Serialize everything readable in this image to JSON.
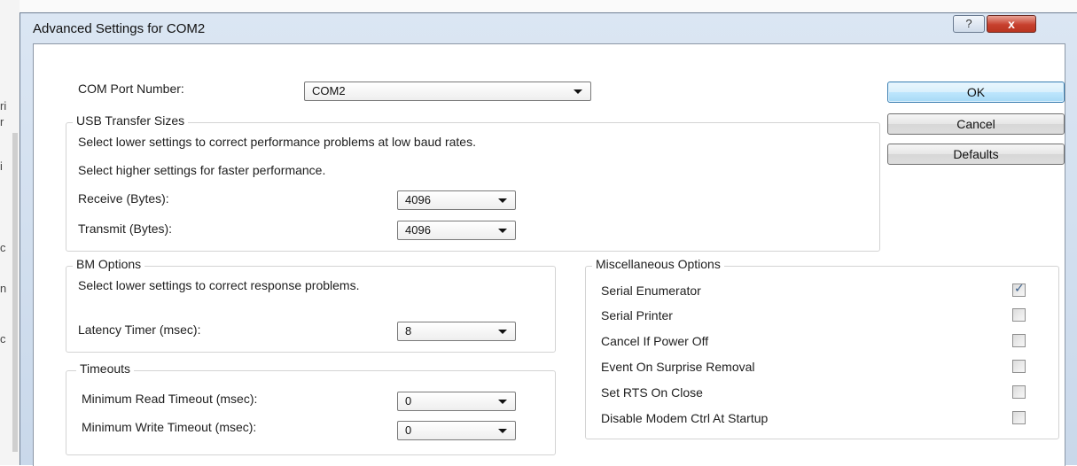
{
  "window": {
    "title": "Advanced Settings for COM2",
    "help_glyph": "?",
    "close_glyph": "x"
  },
  "com_port": {
    "label": "COM Port Number:",
    "value": "COM2"
  },
  "usb": {
    "title": "USB Transfer Sizes",
    "desc1": "Select lower settings to correct performance problems at low baud rates.",
    "desc2": "Select higher settings for faster performance.",
    "receive_label": "Receive (Bytes):",
    "receive_value": "4096",
    "transmit_label": "Transmit (Bytes):",
    "transmit_value": "4096"
  },
  "bm": {
    "title": "BM Options",
    "desc": "Select lower settings to correct response problems.",
    "latency_label": "Latency Timer (msec):",
    "latency_value": "8"
  },
  "timeouts": {
    "title": "Timeouts",
    "read_label": "Minimum Read Timeout (msec):",
    "read_value": "0",
    "write_label": "Minimum Write Timeout (msec):",
    "write_value": "0"
  },
  "misc": {
    "title": "Miscellaneous Options",
    "items": [
      {
        "label": "Serial Enumerator",
        "checked": true
      },
      {
        "label": "Serial Printer",
        "checked": false
      },
      {
        "label": "Cancel If Power Off",
        "checked": false
      },
      {
        "label": "Event On Surprise Removal",
        "checked": false
      },
      {
        "label": "Set RTS On Close",
        "checked": false
      },
      {
        "label": "Disable Modem Ctrl At Startup",
        "checked": false
      }
    ]
  },
  "buttons": {
    "ok": "OK",
    "cancel": "Cancel",
    "defaults": "Defaults"
  },
  "background_fragments": [
    "ri",
    "r",
    "i",
    "c",
    "n",
    "c"
  ],
  "checkmark_glyph": "✓"
}
